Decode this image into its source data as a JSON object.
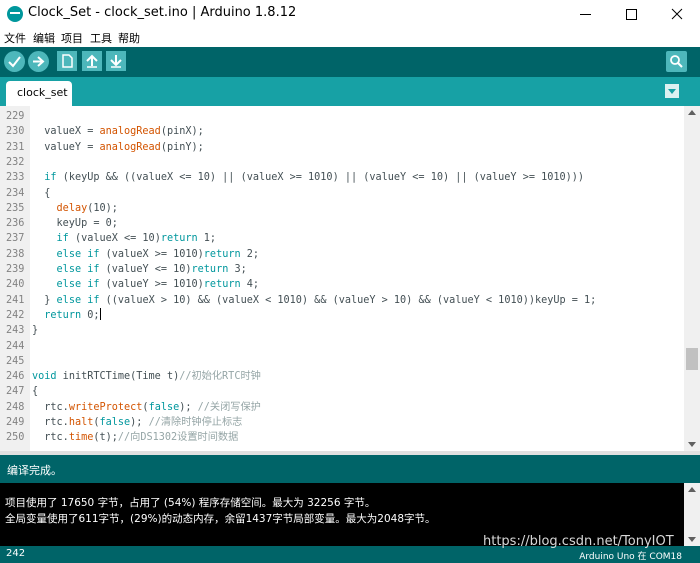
{
  "window": {
    "title": "Clock_Set - clock_set.ino | Arduino 1.8.12"
  },
  "menu": [
    "文件",
    "编辑",
    "项目",
    "工具",
    "帮助"
  ],
  "toolbar": {
    "buttons": [
      "verify-icon",
      "upload-icon",
      "new-icon",
      "open-icon",
      "save-icon",
      "serial-monitor-icon"
    ]
  },
  "tabs": [
    {
      "label": "clock_set"
    }
  ],
  "editor": {
    "lines": [
      {
        "n": "229",
        "html": ""
      },
      {
        "n": "230",
        "html": "  valueX = <span class='fn'>analogRead</span>(pinX);"
      },
      {
        "n": "231",
        "html": "  valueY = <span class='fn'>analogRead</span>(pinY);"
      },
      {
        "n": "232",
        "html": ""
      },
      {
        "n": "233",
        "html": "  <span class='kw'>if</span> (keyUp &amp;&amp; ((valueX &lt;= 10) || (valueX &gt;= 1010) || (valueY &lt;= 10) || (valueY &gt;= 1010)))"
      },
      {
        "n": "234",
        "html": "  {"
      },
      {
        "n": "235",
        "html": "    <span class='fn'>delay</span>(10);"
      },
      {
        "n": "236",
        "html": "    keyUp = 0;"
      },
      {
        "n": "237",
        "html": "    <span class='kw'>if</span> (valueX &lt;= 10)<span class='kw'>return</span> 1;"
      },
      {
        "n": "238",
        "html": "    <span class='kw'>else</span> <span class='kw'>if</span> (valueX &gt;= 1010)<span class='kw'>return</span> 2;"
      },
      {
        "n": "239",
        "html": "    <span class='kw'>else</span> <span class='kw'>if</span> (valueY &lt;= 10)<span class='kw'>return</span> 3;"
      },
      {
        "n": "240",
        "html": "    <span class='kw'>else</span> <span class='kw'>if</span> (valueY &gt;= 1010)<span class='kw'>return</span> 4;"
      },
      {
        "n": "241",
        "html": "  } <span class='kw'>else</span> <span class='kw'>if</span> ((valueX &gt; 10) &amp;&amp; (valueX &lt; 1010) &amp;&amp; (valueY &gt; 10) &amp;&amp; (valueY &lt; 1010))keyUp = 1;"
      },
      {
        "n": "242",
        "html": "  <span class='kw'>return</span> 0;<span class='cursor'></span>"
      },
      {
        "n": "243",
        "html": "}"
      },
      {
        "n": "244",
        "html": ""
      },
      {
        "n": "245",
        "html": ""
      },
      {
        "n": "246",
        "html": "<span class='kw'>void</span> initRTCTime(Time t)<span class='cm'>//初始化RTC时钟</span>"
      },
      {
        "n": "247",
        "html": "{"
      },
      {
        "n": "248",
        "html": "  rtc.<span class='fn'>writeProtect</span>(<span class='kw'>false</span>); <span class='cm'>//关闭写保护</span>"
      },
      {
        "n": "249",
        "html": "  rtc.<span class='fn'>halt</span>(<span class='kw'>false</span>); <span class='cm'>//清除时钟停止标志</span>"
      },
      {
        "n": "250",
        "html": "  rtc.<span class='fn'>time</span>(t);<span class='cm'>//向DS1302设置时间数据</span>"
      }
    ]
  },
  "status": {
    "message": "编译完成。"
  },
  "console": {
    "lines": [
      "项目使用了 17650 字节，占用了 (54%) 程序存储空间。最大为 32256 字节。",
      "全局变量使用了611字节，(29%)的动态内存，余留1437字节局部变量。最大为2048字节。"
    ]
  },
  "footer": {
    "line_number": "242",
    "board": "Arduino Uno 在 COM18"
  },
  "watermark": "https://blog.csdn.net/TonyIOT",
  "colors": {
    "toolbar": "#006468",
    "tabbar": "#17a1a5",
    "button": "#4db7bb",
    "keyword": "#00979d",
    "function": "#d35400"
  }
}
